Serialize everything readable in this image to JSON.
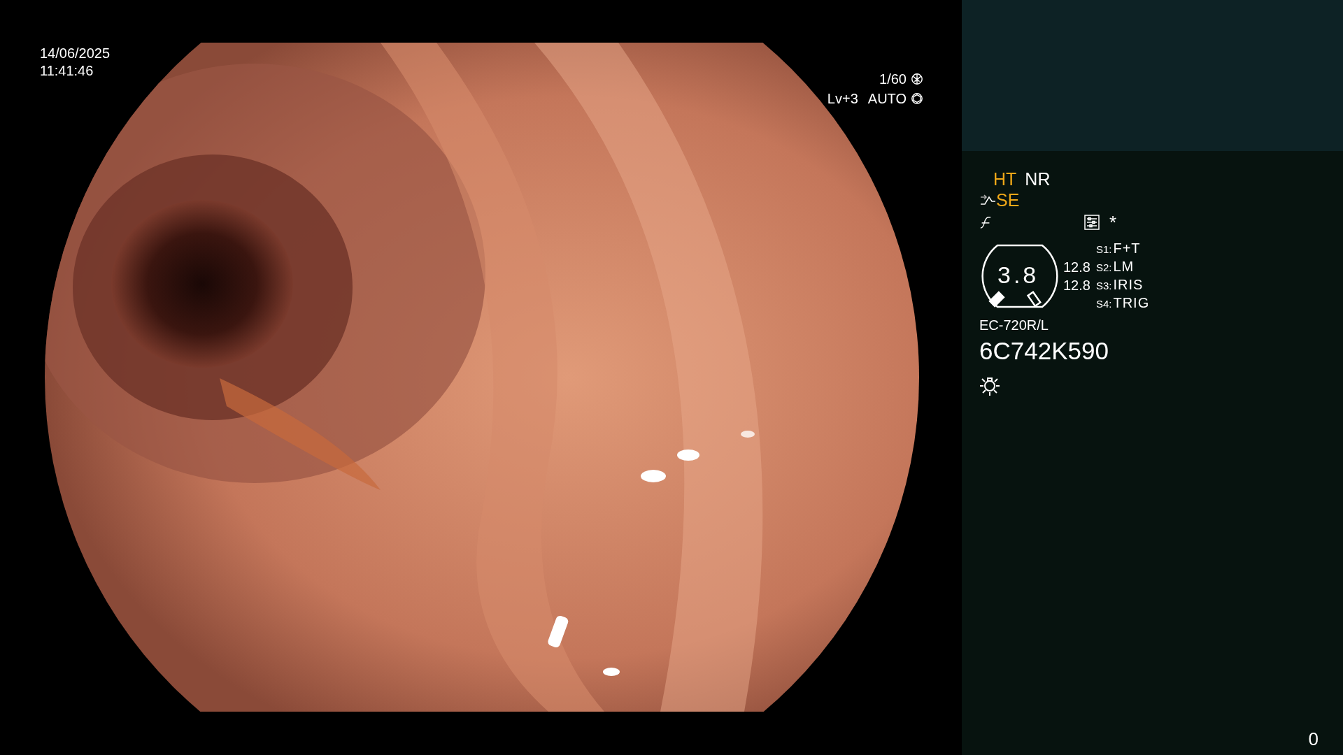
{
  "timestamp": {
    "date": "14/06/2025",
    "time": "11:41:46"
  },
  "exposure": {
    "shutter": "1/60",
    "level": "Lv+3",
    "mode": "AUTO"
  },
  "modes": [
    {
      "label": "HT",
      "highlighted": true
    },
    {
      "label": "NR",
      "highlighted": false
    }
  ],
  "enhancement": {
    "label": "SE",
    "highlighted": true
  },
  "marker": "*",
  "gauge": {
    "value": "3.8",
    "readings": [
      "12.8",
      "12.8"
    ]
  },
  "switches": [
    {
      "key": "S1:",
      "label": "F+T"
    },
    {
      "key": "S2:",
      "label": "LM"
    },
    {
      "key": "S3:",
      "label": "IRIS"
    },
    {
      "key": "S4:",
      "label": "TRIG"
    }
  ],
  "scope_model": "EC-720R/L",
  "serial": "6C742K590",
  "counter": "0"
}
